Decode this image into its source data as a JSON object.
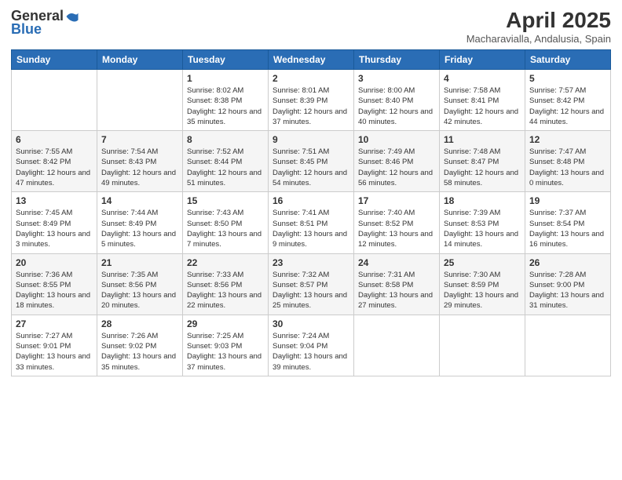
{
  "header": {
    "logo_general": "General",
    "logo_blue": "Blue",
    "title": "April 2025",
    "subtitle": "Macharavialla, Andalusia, Spain"
  },
  "days_of_week": [
    "Sunday",
    "Monday",
    "Tuesday",
    "Wednesday",
    "Thursday",
    "Friday",
    "Saturday"
  ],
  "weeks": [
    [
      {
        "day": "",
        "info": ""
      },
      {
        "day": "",
        "info": ""
      },
      {
        "day": "1",
        "info": "Sunrise: 8:02 AM\nSunset: 8:38 PM\nDaylight: 12 hours and 35 minutes."
      },
      {
        "day": "2",
        "info": "Sunrise: 8:01 AM\nSunset: 8:39 PM\nDaylight: 12 hours and 37 minutes."
      },
      {
        "day": "3",
        "info": "Sunrise: 8:00 AM\nSunset: 8:40 PM\nDaylight: 12 hours and 40 minutes."
      },
      {
        "day": "4",
        "info": "Sunrise: 7:58 AM\nSunset: 8:41 PM\nDaylight: 12 hours and 42 minutes."
      },
      {
        "day": "5",
        "info": "Sunrise: 7:57 AM\nSunset: 8:42 PM\nDaylight: 12 hours and 44 minutes."
      }
    ],
    [
      {
        "day": "6",
        "info": "Sunrise: 7:55 AM\nSunset: 8:42 PM\nDaylight: 12 hours and 47 minutes."
      },
      {
        "day": "7",
        "info": "Sunrise: 7:54 AM\nSunset: 8:43 PM\nDaylight: 12 hours and 49 minutes."
      },
      {
        "day": "8",
        "info": "Sunrise: 7:52 AM\nSunset: 8:44 PM\nDaylight: 12 hours and 51 minutes."
      },
      {
        "day": "9",
        "info": "Sunrise: 7:51 AM\nSunset: 8:45 PM\nDaylight: 12 hours and 54 minutes."
      },
      {
        "day": "10",
        "info": "Sunrise: 7:49 AM\nSunset: 8:46 PM\nDaylight: 12 hours and 56 minutes."
      },
      {
        "day": "11",
        "info": "Sunrise: 7:48 AM\nSunset: 8:47 PM\nDaylight: 12 hours and 58 minutes."
      },
      {
        "day": "12",
        "info": "Sunrise: 7:47 AM\nSunset: 8:48 PM\nDaylight: 13 hours and 0 minutes."
      }
    ],
    [
      {
        "day": "13",
        "info": "Sunrise: 7:45 AM\nSunset: 8:49 PM\nDaylight: 13 hours and 3 minutes."
      },
      {
        "day": "14",
        "info": "Sunrise: 7:44 AM\nSunset: 8:49 PM\nDaylight: 13 hours and 5 minutes."
      },
      {
        "day": "15",
        "info": "Sunrise: 7:43 AM\nSunset: 8:50 PM\nDaylight: 13 hours and 7 minutes."
      },
      {
        "day": "16",
        "info": "Sunrise: 7:41 AM\nSunset: 8:51 PM\nDaylight: 13 hours and 9 minutes."
      },
      {
        "day": "17",
        "info": "Sunrise: 7:40 AM\nSunset: 8:52 PM\nDaylight: 13 hours and 12 minutes."
      },
      {
        "day": "18",
        "info": "Sunrise: 7:39 AM\nSunset: 8:53 PM\nDaylight: 13 hours and 14 minutes."
      },
      {
        "day": "19",
        "info": "Sunrise: 7:37 AM\nSunset: 8:54 PM\nDaylight: 13 hours and 16 minutes."
      }
    ],
    [
      {
        "day": "20",
        "info": "Sunrise: 7:36 AM\nSunset: 8:55 PM\nDaylight: 13 hours and 18 minutes."
      },
      {
        "day": "21",
        "info": "Sunrise: 7:35 AM\nSunset: 8:56 PM\nDaylight: 13 hours and 20 minutes."
      },
      {
        "day": "22",
        "info": "Sunrise: 7:33 AM\nSunset: 8:56 PM\nDaylight: 13 hours and 22 minutes."
      },
      {
        "day": "23",
        "info": "Sunrise: 7:32 AM\nSunset: 8:57 PM\nDaylight: 13 hours and 25 minutes."
      },
      {
        "day": "24",
        "info": "Sunrise: 7:31 AM\nSunset: 8:58 PM\nDaylight: 13 hours and 27 minutes."
      },
      {
        "day": "25",
        "info": "Sunrise: 7:30 AM\nSunset: 8:59 PM\nDaylight: 13 hours and 29 minutes."
      },
      {
        "day": "26",
        "info": "Sunrise: 7:28 AM\nSunset: 9:00 PM\nDaylight: 13 hours and 31 minutes."
      }
    ],
    [
      {
        "day": "27",
        "info": "Sunrise: 7:27 AM\nSunset: 9:01 PM\nDaylight: 13 hours and 33 minutes."
      },
      {
        "day": "28",
        "info": "Sunrise: 7:26 AM\nSunset: 9:02 PM\nDaylight: 13 hours and 35 minutes."
      },
      {
        "day": "29",
        "info": "Sunrise: 7:25 AM\nSunset: 9:03 PM\nDaylight: 13 hours and 37 minutes."
      },
      {
        "day": "30",
        "info": "Sunrise: 7:24 AM\nSunset: 9:04 PM\nDaylight: 13 hours and 39 minutes."
      },
      {
        "day": "",
        "info": ""
      },
      {
        "day": "",
        "info": ""
      },
      {
        "day": "",
        "info": ""
      }
    ]
  ]
}
